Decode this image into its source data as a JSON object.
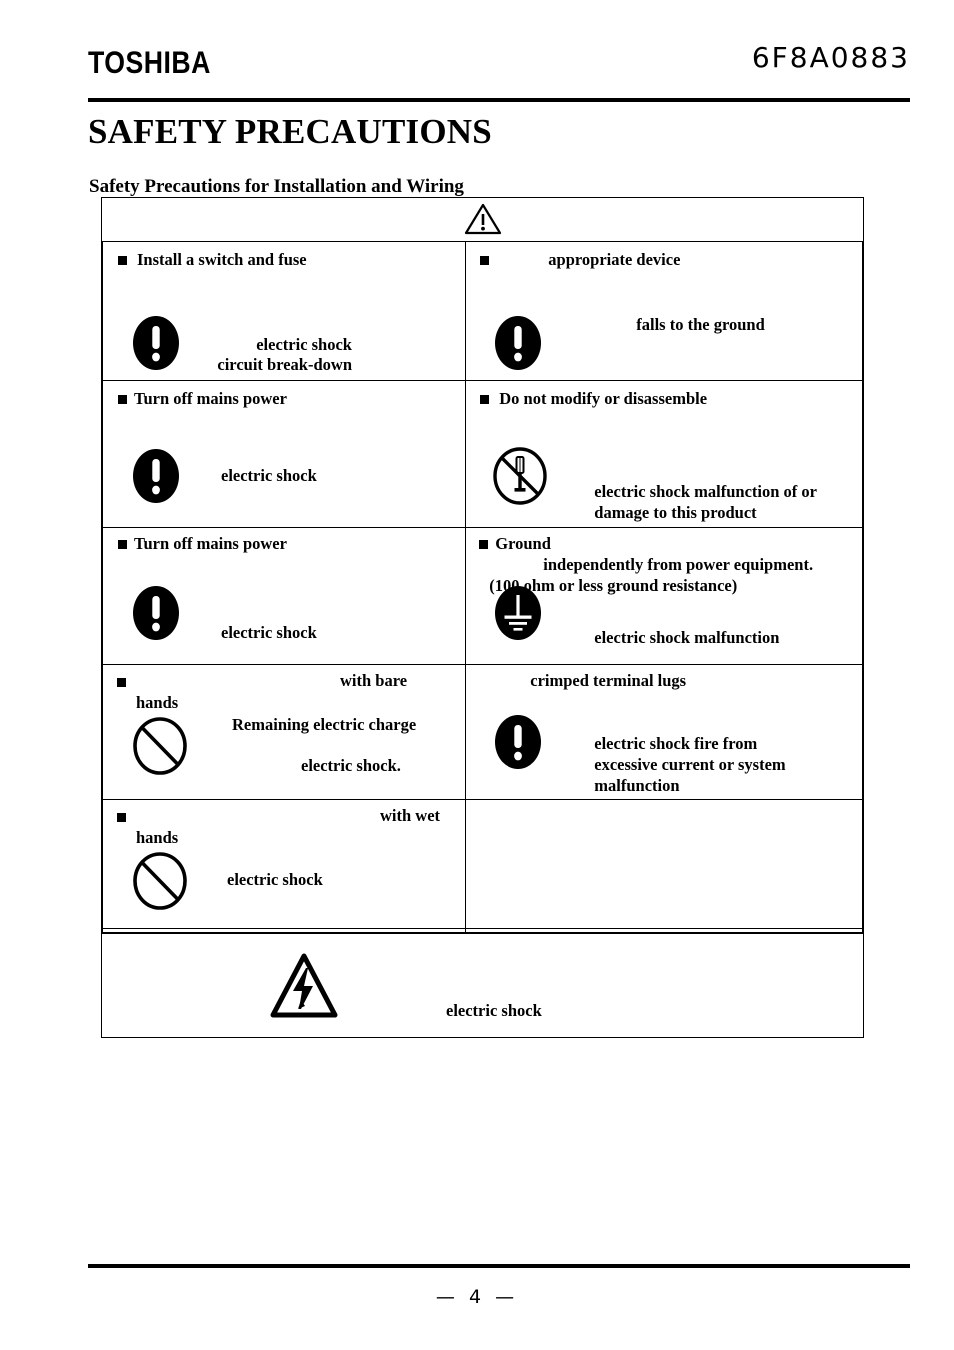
{
  "header": {
    "logo_text": "TOSHIBA",
    "doc_number": "6F8A0883"
  },
  "title": "SAFETY PRECAUTIONS",
  "section_title": "Safety Precautions for Installation and Wiring",
  "table": {
    "header_icon": "warning-triangle-icon",
    "rows": [
      {
        "left": {
          "icon": "exclamation-filled-circle-icon",
          "heading": "Install a switch and fuse",
          "lines": [
            "electric shock",
            "circuit break-down"
          ]
        },
        "right": {
          "icon": "exclamation-filled-circle-icon",
          "heading": "appropriate device",
          "lines": [
            "falls to the ground"
          ]
        }
      },
      {
        "left": {
          "icon": "exclamation-filled-circle-icon",
          "heading": "Turn off mains power",
          "lines": [
            "electric shock"
          ]
        },
        "right": {
          "icon": "no-disassemble-screwdriver-icon",
          "heading": "Do not modify or disassemble",
          "lines": [
            "electric shock  malfunction of or",
            "damage to this product"
          ]
        }
      },
      {
        "left": {
          "icon": "exclamation-filled-circle-icon",
          "heading": "Turn off mains power",
          "lines": [
            "electric shock"
          ]
        },
        "right": {
          "icon": "ground-earth-icon",
          "heading": "Ground",
          "lines": [
            "independently from power equipment.",
            "(100 ohm or less ground resistance)",
            "electric shock     malfunction"
          ]
        }
      },
      {
        "left": {
          "icon": "prohibition-circle-icon",
          "heading": "with bare",
          "lines": [
            "hands",
            "Remaining electric charge",
            "electric shock."
          ]
        },
        "right": {
          "icon": "exclamation-filled-circle-icon",
          "heading": "crimped terminal lugs",
          "lines": [
            "electric shock  fire from",
            "excessive current or system",
            "malfunction"
          ]
        }
      },
      {
        "left": {
          "icon": "prohibition-circle-icon",
          "heading": "with wet",
          "lines": [
            "hands",
            "electric shock"
          ]
        },
        "right": {
          "icon": "",
          "heading": "",
          "lines": []
        }
      }
    ],
    "high_voltage_row": {
      "icon": "high-voltage-triangle-icon",
      "text": "electric shock"
    }
  },
  "footer": {
    "page_marker": "—  4  —"
  },
  "colors": {
    "ink": "#000000",
    "paper": "#ffffff"
  }
}
